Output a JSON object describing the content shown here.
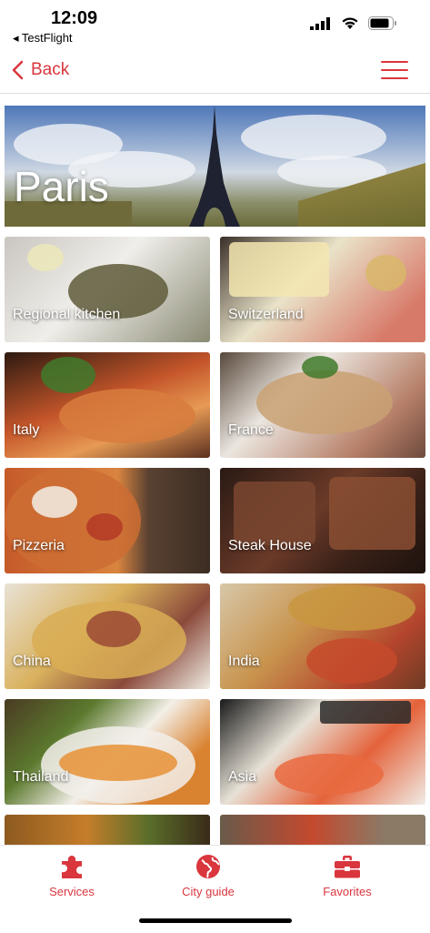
{
  "status_bar": {
    "time": "12:09",
    "back_app": "◂ TestFlight"
  },
  "nav": {
    "back_label": "Back"
  },
  "hero": {
    "title": "Paris"
  },
  "categories": [
    {
      "label": "Regional kitchen"
    },
    {
      "label": "Switzerland"
    },
    {
      "label": "Italy"
    },
    {
      "label": "France"
    },
    {
      "label": "Pizzeria"
    },
    {
      "label": "Steak House"
    },
    {
      "label": "China"
    },
    {
      "label": "India"
    },
    {
      "label": "Thailand"
    },
    {
      "label": "Asia"
    }
  ],
  "tab_bar": {
    "tabs": [
      {
        "label": "Services",
        "icon": "puzzle-icon"
      },
      {
        "label": "City guide",
        "icon": "globe-icon"
      },
      {
        "label": "Favorites",
        "icon": "briefcase-icon"
      }
    ]
  },
  "colors": {
    "accent": "#d9363e"
  }
}
